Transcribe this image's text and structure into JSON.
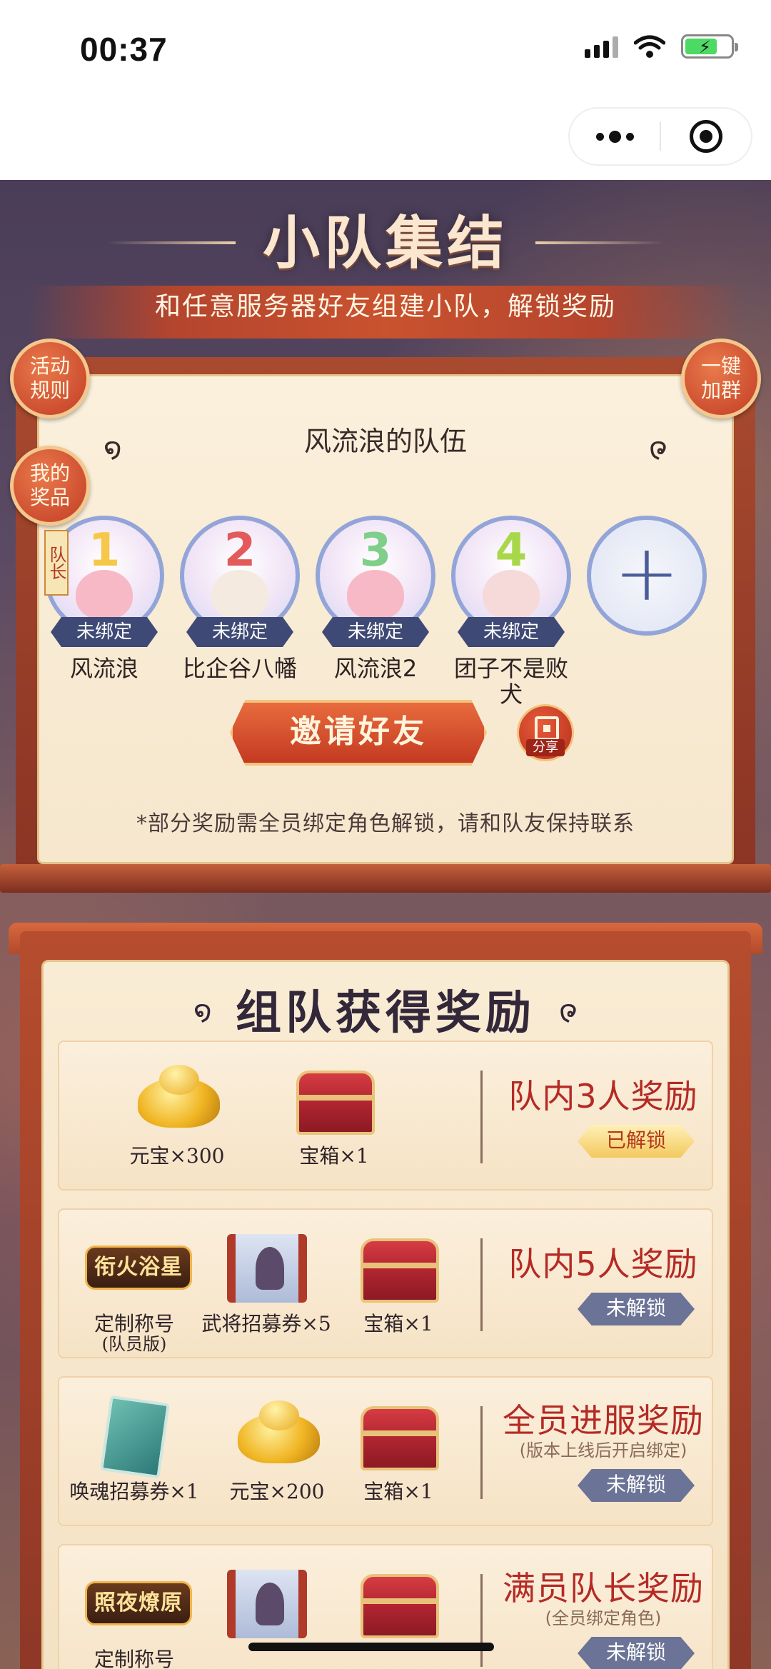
{
  "status_bar": {
    "time": "00:37"
  },
  "header": {
    "title": "小队集结",
    "subtitle": "和任意服务器好友组建小队，解锁奖励"
  },
  "side_buttons": {
    "rules": "活动\n规则",
    "prizes": "我的\n奖品",
    "join_group": "一键\n加群"
  },
  "team": {
    "name": "风流浪的队伍",
    "leader_tag": "队长",
    "members": [
      {
        "name": "风流浪",
        "tag": "未绑定",
        "badge": "1",
        "badge_color": "#f6c84a"
      },
      {
        "name": "比企谷八幡",
        "tag": "未绑定",
        "badge": "2",
        "badge_color": "#e25a5a"
      },
      {
        "name": "风流浪2",
        "tag": "未绑定",
        "badge": "3",
        "badge_color": "#7fcf8a"
      },
      {
        "name": "团子不是败犬",
        "tag": "未绑定",
        "badge": "4",
        "badge_color": "#a8d84a"
      }
    ],
    "invite_label": "邀请好友",
    "share_label": "分享",
    "note": "*部分奖励需全员绑定角色解锁，请和队友保持联系"
  },
  "rewards": {
    "title": "组队获得奖励",
    "rows": [
      {
        "title": "队内3人奖励",
        "subtitle": "",
        "status": "已解锁",
        "unlocked": true,
        "items": [
          {
            "icon": "gold-ingot-icon",
            "label": "元宝×300",
            "sublabel": ""
          },
          {
            "icon": "treasure-chest-icon",
            "label": "宝箱×1",
            "sublabel": ""
          }
        ]
      },
      {
        "title": "队内5人奖励",
        "subtitle": "",
        "status": "未解锁",
        "unlocked": false,
        "items": [
          {
            "icon": "title-badge-icon",
            "badge_text": "衔火浴星",
            "label": "定制称号",
            "sublabel": "(队员版)"
          },
          {
            "icon": "recruit-scroll-icon",
            "label": "武将招募券×5",
            "sublabel": ""
          },
          {
            "icon": "treasure-chest-icon",
            "label": "宝箱×1",
            "sublabel": ""
          }
        ]
      },
      {
        "title": "全员进服奖励",
        "subtitle": "(版本上线后开启绑定)",
        "status": "未解锁",
        "unlocked": false,
        "items": [
          {
            "icon": "soul-card-icon",
            "label": "唤魂招募券×1",
            "sublabel": ""
          },
          {
            "icon": "gold-ingot-icon",
            "label": "元宝×200",
            "sublabel": ""
          },
          {
            "icon": "treasure-chest-icon",
            "label": "宝箱×1",
            "sublabel": ""
          }
        ]
      },
      {
        "title": "满员队长奖励",
        "subtitle": "(全员绑定角色)",
        "status": "未解锁",
        "unlocked": false,
        "items": [
          {
            "icon": "title-badge-icon",
            "badge_text": "照夜燎原",
            "label": "定制称号",
            "sublabel": ""
          },
          {
            "icon": "recruit-scroll-icon",
            "label": "",
            "sublabel": ""
          },
          {
            "icon": "treasure-chest-icon",
            "label": "",
            "sublabel": ""
          }
        ]
      }
    ]
  }
}
